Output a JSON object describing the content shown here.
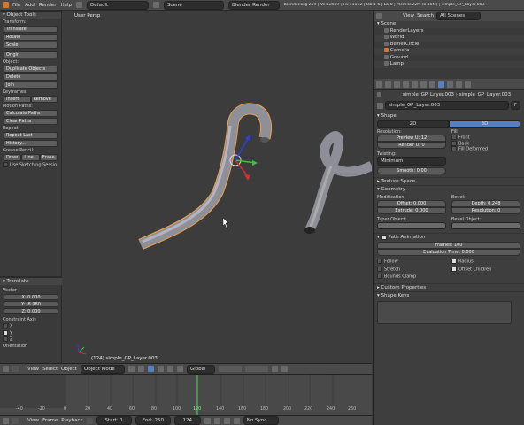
{
  "topbar": {
    "menus": [
      "File",
      "Add",
      "Render",
      "Help"
    ],
    "layout": "Default",
    "scene": "Scene",
    "engine": "Blender Render",
    "info": "blender.org 259 | Ve:12637 | Fa:11162 | Ob:1-6 | La:0 | Mem:8.22M (0.10M) | simple_GP_Layer.003"
  },
  "toolshelf": {
    "title": "Object Tools",
    "transform_label": "Transform:",
    "transform": [
      "Translate",
      "Rotate",
      "Scale"
    ],
    "origin": "Origin",
    "object_label": "Object:",
    "object_buttons": [
      "Duplicate Objects",
      "Delete",
      "Join"
    ],
    "keyframes_label": "Keyframes:",
    "insert": "Insert",
    "remove": "Remove",
    "motion_label": "Motion Paths:",
    "motion": [
      "Calculate Paths",
      "Clear Paths"
    ],
    "repeat_label": "Repeat:",
    "repeat": [
      "Repeat Last",
      "History..."
    ],
    "grease_label": "Grease Pencil:",
    "grease": [
      "Draw",
      "Line",
      "Erase"
    ],
    "sketch": "Use Sketching Sessio",
    "op_title": "Translate",
    "vector_label": "Vector",
    "x": "X: 0.000",
    "y": "Y: -8.980",
    "z": "Z: 0.000",
    "constraint_label": "Constraint Axis",
    "axes": [
      "X",
      "Y",
      "Z"
    ],
    "orientation_label": "Orientation"
  },
  "viewport": {
    "label": "User Persp",
    "object_label": "(124) simple_GP_Layer.003"
  },
  "vpbar": {
    "items": [
      "View",
      "Select",
      "Object"
    ],
    "mode": "Object Mode",
    "orientation": "Global"
  },
  "timeline": {
    "ticks": [
      "-40",
      "-20",
      "0",
      "20",
      "40",
      "60",
      "80",
      "100",
      "120",
      "140",
      "160",
      "180",
      "200",
      "220",
      "240",
      "260"
    ],
    "current_frame_value": 124
  },
  "tlbar": {
    "items": [
      "View",
      "Frame",
      "Playback"
    ],
    "start": "Start: 1",
    "end": "End: 250",
    "current": "124",
    "sync": "No Sync"
  },
  "outliner": {
    "view": "View",
    "search": "Search",
    "filter": "All Scenes",
    "rows": [
      "Scene",
      "RenderLayers",
      "World",
      "BezierCircle",
      "Camera",
      "Ground",
      "Lamp"
    ]
  },
  "props": {
    "breadcrumb1": "simple_GP_Layer.003",
    "breadcrumb2": "simple_GP_Layer.003",
    "datablock": "simple_GP_Layer.003",
    "datablock_flag": "F",
    "shape_section": "Shape",
    "tab_2d": "2D",
    "tab_3d": "3D",
    "resolution_label": "Resolution:",
    "preview_u": "Preview U: 12",
    "render_u": "Render U: 0",
    "fill_label": "Fill:",
    "fill_front": "Front",
    "fill_back": "Back",
    "fill_deformed": "Fill Deformed",
    "twisting_label": "Twisting:",
    "twisting_value": "Minimum",
    "smooth": "Smooth: 0.00",
    "texture_space": "Texture Space",
    "geometry_section": "Geometry",
    "modification_label": "Modification:",
    "bevel_label": "Bevel:",
    "offset": "Offset: 0.000",
    "extrude": "Extrude: 0.000",
    "depth": "Depth: 0.248",
    "resolution": "Resolution: 0",
    "taper_label": "Taper Object:",
    "bevel_object_label": "Bevel Object:",
    "path_section": "Path Animation",
    "frames": "Frames: 100",
    "eval_time": "Evaluation Time: 0.000",
    "follow": "Follow",
    "radius": "Radius",
    "stretch": "Stretch",
    "offset_children": "Offset Children",
    "bounds_clamp": "Bounds Clamp",
    "custom_props": "Custom Properties",
    "shape_keys": "Shape Keys"
  },
  "colors": {
    "accent": "#5680c2",
    "selection_outline": "#f0a040"
  }
}
